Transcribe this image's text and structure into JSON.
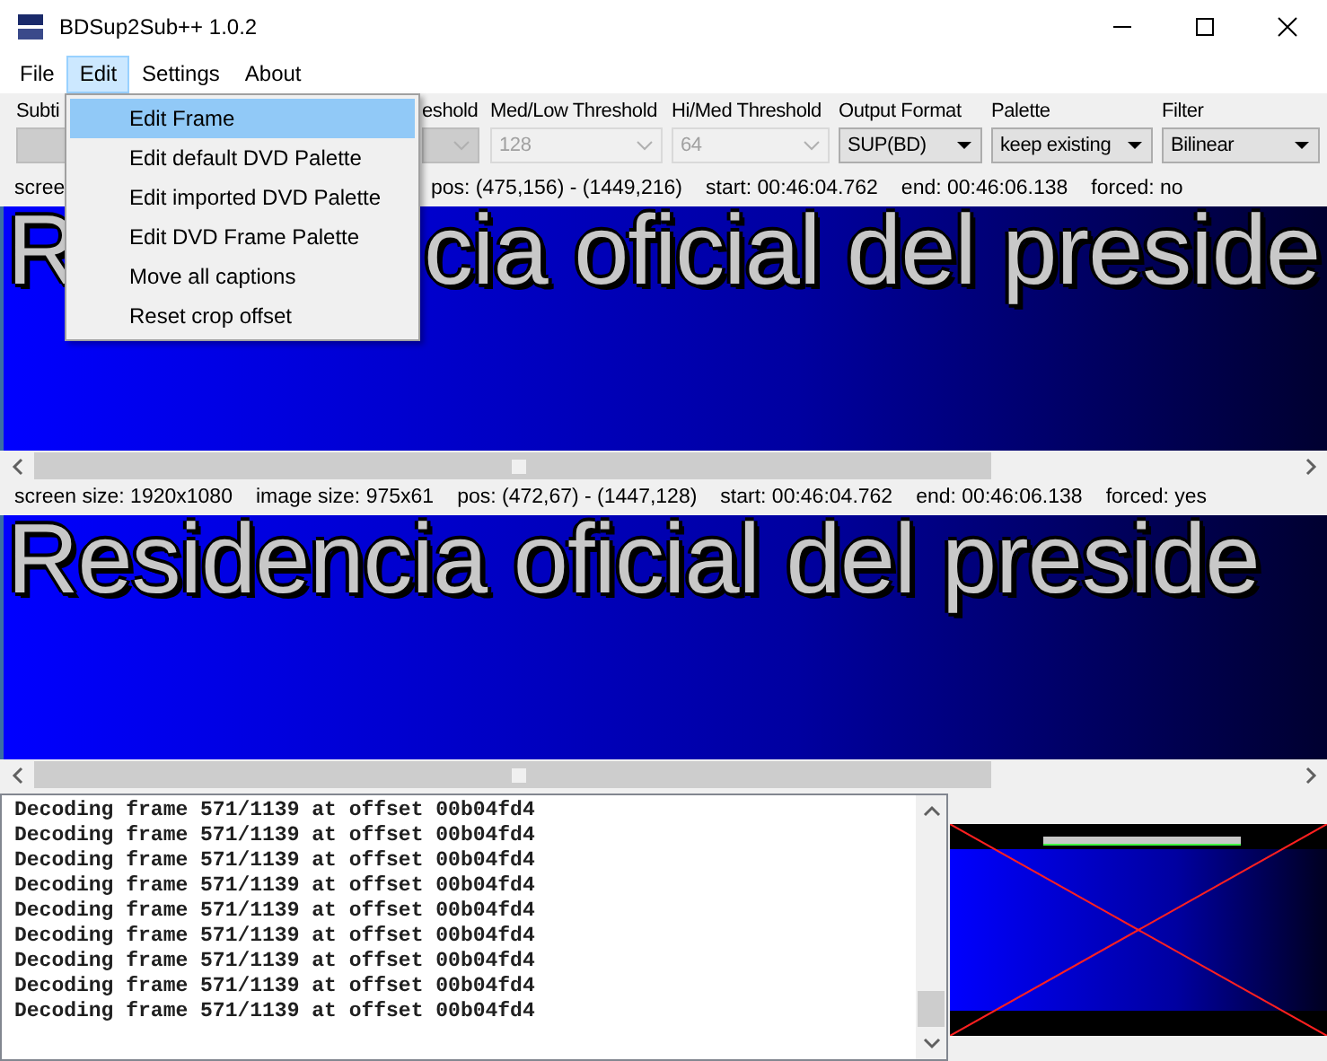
{
  "window": {
    "title": "BDSup2Sub++ 1.0.2"
  },
  "menu_bar": [
    {
      "label": "File",
      "selected": false
    },
    {
      "label": "Edit",
      "selected": true
    },
    {
      "label": "Settings",
      "selected": false
    },
    {
      "label": "About",
      "selected": false
    }
  ],
  "edit_menu": [
    {
      "label": "Edit Frame",
      "selected": true
    },
    {
      "label": "Edit default DVD Palette",
      "selected": false
    },
    {
      "label": "Edit imported DVD Palette",
      "selected": false
    },
    {
      "label": "Edit DVD Frame Palette",
      "selected": false
    },
    {
      "label": "Move all captions",
      "selected": false
    },
    {
      "label": "Reset crop offset",
      "selected": false
    }
  ],
  "toolbar": [
    {
      "label": "Subti",
      "disabled": true,
      "arrow": false
    },
    {
      "label": "eshold",
      "disabled": true
    },
    {
      "label": "Med/Low Threshold",
      "value": "128",
      "disabled": true
    },
    {
      "label": "Hi/Med Threshold",
      "value": "64",
      "disabled": true
    },
    {
      "label": "Output Format",
      "value": "SUP(BD)",
      "disabled": false
    },
    {
      "label": "Palette",
      "value": "keep existing",
      "disabled": false
    },
    {
      "label": "Filter",
      "value": "Bilinear",
      "disabled": false
    }
  ],
  "source_panel": {
    "info": [
      "scree",
      "pos: (475,156) - (1449,216)",
      "start: 00:46:04.762",
      "end: 00:46:06.138",
      "forced: no"
    ],
    "caption": [
      "R",
      "cia oficial del preside"
    ]
  },
  "target_panel": {
    "info": [
      "screen size: 1920x1080",
      "image size: 975x61",
      "pos: (472,67) - (1447,128)",
      "start: 00:46:04.762",
      "end: 00:46:06.138",
      "forced: yes"
    ],
    "caption": [
      "Residencia oficial del preside"
    ]
  },
  "log": [
    "Decoding frame 571/1139 at offset 00b04fd4",
    "Decoding frame 571/1139 at offset 00b04fd4",
    "Decoding frame 571/1139 at offset 00b04fd4",
    "Decoding frame 571/1139 at offset 00b04fd4",
    "Decoding frame 571/1139 at offset 00b04fd4",
    "Decoding frame 571/1139 at offset 00b04fd4",
    "Decoding frame 571/1139 at offset 00b04fd4",
    "Decoding frame 571/1139 at offset 00b04fd4",
    "Decoding frame 571/1139 at offset 00b04fd4"
  ]
}
